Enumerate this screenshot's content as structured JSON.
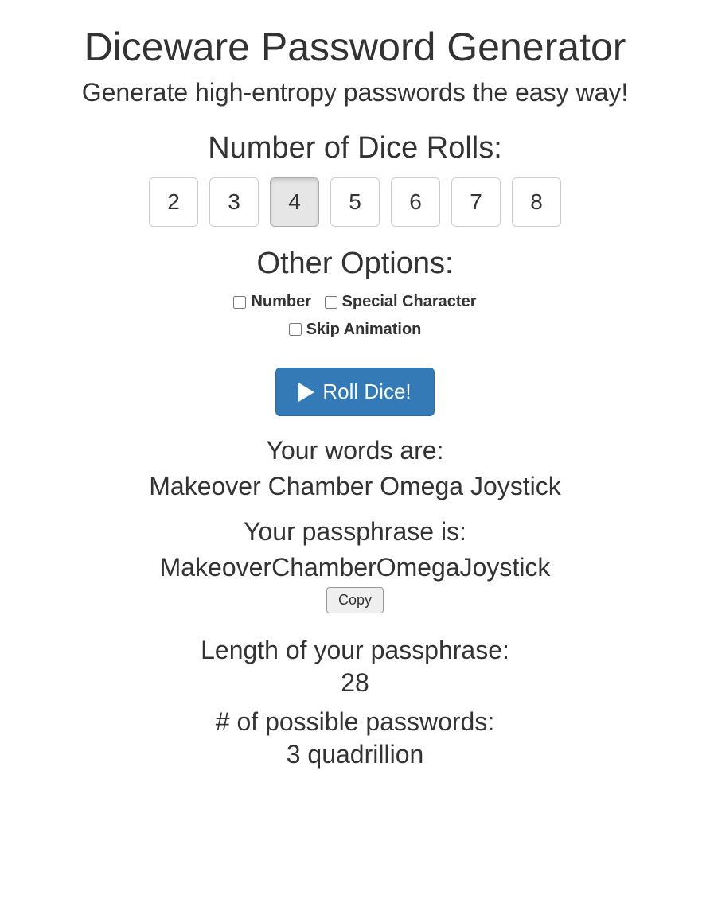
{
  "header": {
    "title": "Diceware Password Generator",
    "subtitle": "Generate high-entropy passwords the easy way!"
  },
  "dice": {
    "label": "Number of Dice Rolls:",
    "options": [
      "2",
      "3",
      "4",
      "5",
      "6",
      "7",
      "8"
    ],
    "active_value": "4"
  },
  "other_options": {
    "heading": "Other Options:",
    "number_label": "Number",
    "special_label": "Special Character",
    "skip_label": "Skip Animation",
    "number_checked": false,
    "special_checked": false,
    "skip_checked": false
  },
  "actions": {
    "roll_label": "Roll Dice!",
    "copy_label": "Copy"
  },
  "results": {
    "words_label": "Your words are:",
    "words_value": "Makeover Chamber Omega Joystick",
    "passphrase_label": "Your passphrase is:",
    "passphrase_value": "MakeoverChamberOmegaJoystick",
    "length_label": "Length of your passphrase:",
    "length_value": "28",
    "possible_label": "# of possible passwords:",
    "possible_value": "3 quadrillion"
  }
}
